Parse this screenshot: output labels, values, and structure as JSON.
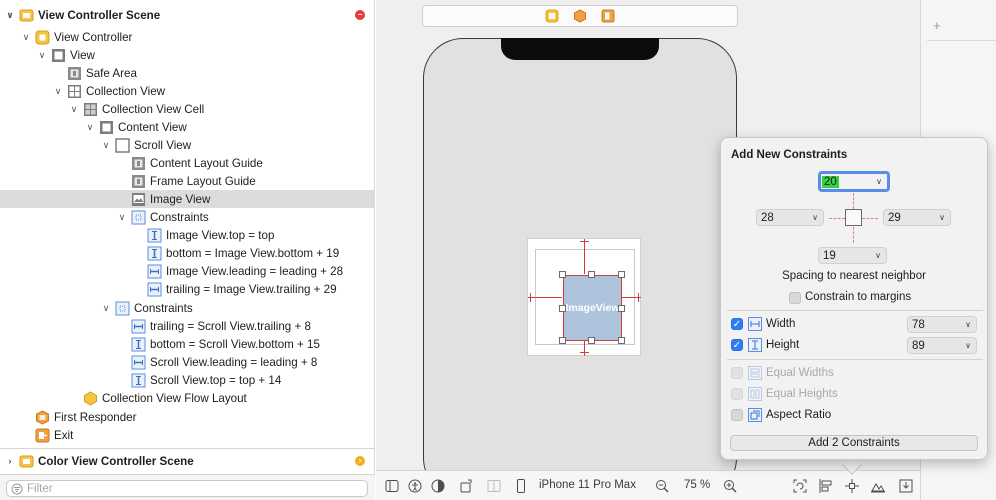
{
  "outline": {
    "scene1": "View Controller Scene",
    "items": [
      {
        "label": "View Controller"
      },
      {
        "label": "View"
      },
      {
        "label": "Safe Area"
      },
      {
        "label": "Collection View"
      },
      {
        "label": "Collection View Cell"
      },
      {
        "label": "Content View"
      },
      {
        "label": "Scroll View"
      },
      {
        "label": "Content Layout Guide"
      },
      {
        "label": "Frame Layout Guide"
      },
      {
        "label": "Image View"
      },
      {
        "label": "Constraints"
      },
      {
        "label": "Image View.top = top"
      },
      {
        "label": "bottom = Image View.bottom + 19"
      },
      {
        "label": "Image View.leading = leading + 28"
      },
      {
        "label": "trailing = Image View.trailing + 29"
      },
      {
        "label": "Constraints"
      },
      {
        "label": "trailing = Scroll View.trailing + 8"
      },
      {
        "label": "bottom = Scroll View.bottom + 15"
      },
      {
        "label": "Scroll View.leading = leading + 8"
      },
      {
        "label": "Scroll View.top = top + 14"
      },
      {
        "label": "Collection View Flow Layout"
      },
      {
        "label": "First Responder"
      },
      {
        "label": "Exit"
      }
    ],
    "scene2": "Color View Controller Scene",
    "filter_placeholder": "Filter"
  },
  "canvas": {
    "image_view_label": "ImageView",
    "device_name": "iPhone 11 Pro Max",
    "zoom": "75 %"
  },
  "constraints_popover": {
    "title": "Add New Constraints",
    "top": "20",
    "left": "28",
    "right": "29",
    "bottom": "19",
    "spacing_label": "Spacing to nearest neighbor",
    "constrain_margins": "Constrain to margins",
    "width_label": "Width",
    "width_value": "78",
    "height_label": "Height",
    "height_value": "89",
    "equal_widths": "Equal Widths",
    "equal_heights": "Equal Heights",
    "aspect_ratio": "Aspect Ratio",
    "add_button": "Add 2 Constraints"
  },
  "colors": {
    "selection": "#dcdcdc",
    "constraint_red": "#d23b3b",
    "checkbox_blue": "#2f7cf6",
    "focus_ring": "#5a8de8",
    "highlight_green": "#36d140"
  }
}
